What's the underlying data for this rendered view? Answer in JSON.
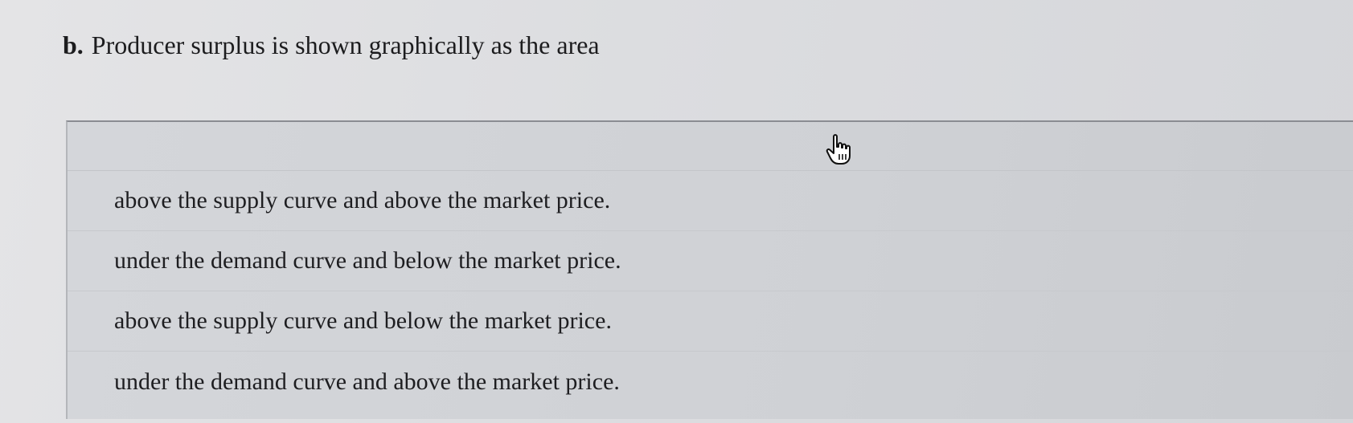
{
  "question": {
    "letter": "b.",
    "text": "Producer surplus is shown graphically as the area"
  },
  "dropdown": {
    "selected_value": "",
    "options": [
      "above the supply curve and above the market price.",
      "under the demand curve and below the market price.",
      "above the supply curve and below the market price.",
      "under the demand curve and above the market price."
    ]
  },
  "cursor": {
    "icon": "hand-pointer-icon"
  }
}
